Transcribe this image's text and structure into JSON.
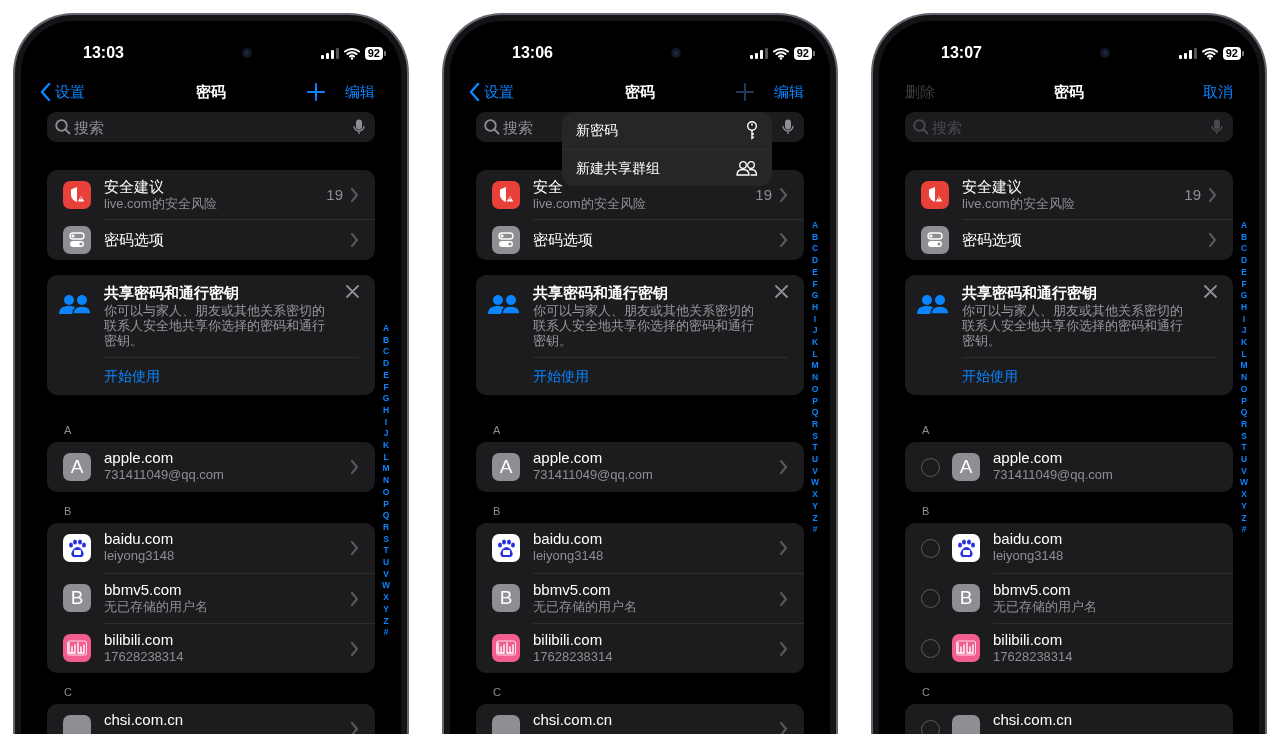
{
  "phones": [
    {
      "status_bar": {
        "time": "13:03",
        "battery": "92"
      },
      "nav": {
        "left": {
          "kind": "back",
          "label": "设置",
          "disabled": false
        },
        "title": "密码",
        "add": {
          "disabled": false
        },
        "right": {
          "label": "编辑"
        }
      },
      "search": {
        "placeholder": "搜索",
        "disabled": false
      },
      "security": [
        {
          "kind": "advice",
          "title": "安全建议",
          "subtitle": "live.com的安全风险",
          "count": "19"
        },
        {
          "kind": "options",
          "title": "密码选项"
        }
      ],
      "share_card": {
        "title": "共享密码和通行密钥",
        "text": "你可以与家人、朋友或其他关系密切的联系人安全地共享你选择的密码和通行密钥。",
        "action": "开始使用"
      },
      "index": [
        "A",
        "B",
        "C",
        "D",
        "E",
        "F",
        "G",
        "H",
        "I",
        "J",
        "K",
        "L",
        "M",
        "N",
        "O",
        "P",
        "Q",
        "R",
        "S",
        "T",
        "U",
        "V",
        "W",
        "X",
        "Y",
        "Z",
        "#"
      ],
      "sections": [
        {
          "letter": "A",
          "entries": [
            {
              "site": "apple.com",
              "user": "731411049@qq.com",
              "kind": "letter",
              "icon_text": "A"
            }
          ]
        },
        {
          "letter": "B",
          "entries": [
            {
              "site": "baidu.com",
              "user": "leiyong3148",
              "kind": "baidu"
            },
            {
              "site": "bbmv5.com",
              "user": "无已存储的用户名",
              "kind": "letter",
              "icon_text": "B"
            },
            {
              "site": "bilibili.com",
              "user": "17628238314",
              "kind": "bilibili"
            }
          ]
        },
        {
          "letter": "C",
          "entries": [
            {
              "site": "chsi.com.cn",
              "kind": "letter"
            }
          ]
        }
      ]
    },
    {
      "status_bar": {
        "time": "13:06",
        "battery": "92"
      },
      "nav": {
        "left": {
          "kind": "back",
          "label": "设置",
          "disabled": false
        },
        "title": "密码",
        "add": {
          "disabled": true
        },
        "right": {
          "label": "编辑"
        }
      },
      "search": {
        "placeholder": "搜索",
        "disabled": false
      },
      "menu": [
        {
          "label": "新密码",
          "kind": "key"
        },
        {
          "label": "新建共享群组",
          "kind": "group"
        }
      ],
      "security": [
        {
          "kind": "advice",
          "title": "安全",
          "subtitle": "live.com的安全风险",
          "count": "19"
        },
        {
          "kind": "options",
          "title": "密码选项"
        }
      ],
      "share_card": {
        "title": "共享密码和通行密钥",
        "text": "你可以与家人、朋友或其他关系密切的联系人安全地共享你选择的密码和通行密钥。",
        "action": "开始使用"
      },
      "index": [
        "A",
        "B",
        "C",
        "D",
        "E",
        "F",
        "G",
        "H",
        "I",
        "J",
        "K",
        "L",
        "M",
        "N",
        "O",
        "P",
        "Q",
        "R",
        "S",
        "T",
        "U",
        "V",
        "W",
        "X",
        "Y",
        "Z",
        "#"
      ],
      "sections": [
        {
          "letter": "A",
          "entries": [
            {
              "site": "apple.com",
              "user": "731411049@qq.com",
              "kind": "letter",
              "icon_text": "A"
            }
          ]
        },
        {
          "letter": "B",
          "entries": [
            {
              "site": "baidu.com",
              "user": "leiyong3148",
              "kind": "baidu"
            },
            {
              "site": "bbmv5.com",
              "user": "无已存储的用户名",
              "kind": "letter",
              "icon_text": "B"
            },
            {
              "site": "bilibili.com",
              "user": "17628238314",
              "kind": "bilibili"
            }
          ]
        },
        {
          "letter": "C",
          "entries": [
            {
              "site": "chsi.com.cn",
              "kind": "letter"
            }
          ]
        }
      ]
    },
    {
      "status_bar": {
        "time": "13:07",
        "battery": "92"
      },
      "nav": {
        "left": {
          "kind": "text",
          "label": "删除",
          "disabled": true
        },
        "title": "密码",
        "right": {
          "label": "取消"
        }
      },
      "search": {
        "placeholder": "搜索",
        "disabled": true
      },
      "security": [
        {
          "kind": "advice",
          "title": "安全建议",
          "subtitle": "live.com的安全风险",
          "count": "19"
        },
        {
          "kind": "options",
          "title": "密码选项"
        }
      ],
      "share_card": {
        "title": "共享密码和通行密钥",
        "text": "你可以与家人、朋友或其他关系密切的联系人安全地共享你选择的密码和通行密钥。",
        "action": "开始使用"
      },
      "index": [
        "A",
        "B",
        "C",
        "D",
        "E",
        "F",
        "G",
        "H",
        "I",
        "J",
        "K",
        "L",
        "M",
        "N",
        "O",
        "P",
        "Q",
        "R",
        "S",
        "T",
        "U",
        "V",
        "W",
        "X",
        "Y",
        "Z",
        "#"
      ],
      "sections": [
        {
          "letter": "A",
          "entries": [
            {
              "site": "apple.com",
              "user": "731411049@qq.com",
              "kind": "letter",
              "icon_text": "A",
              "selected": false
            }
          ]
        },
        {
          "letter": "B",
          "entries": [
            {
              "site": "baidu.com",
              "user": "leiyong3148",
              "kind": "baidu",
              "selected": false
            },
            {
              "site": "bbmv5.com",
              "user": "无已存储的用户名",
              "kind": "letter",
              "icon_text": "B",
              "selected": false
            },
            {
              "site": "bilibili.com",
              "user": "17628238314",
              "kind": "bilibili",
              "selected": false
            }
          ]
        },
        {
          "letter": "C",
          "entries": [
            {
              "site": "chsi.com.cn",
              "kind": "letter",
              "selected": false
            }
          ]
        }
      ]
    }
  ]
}
